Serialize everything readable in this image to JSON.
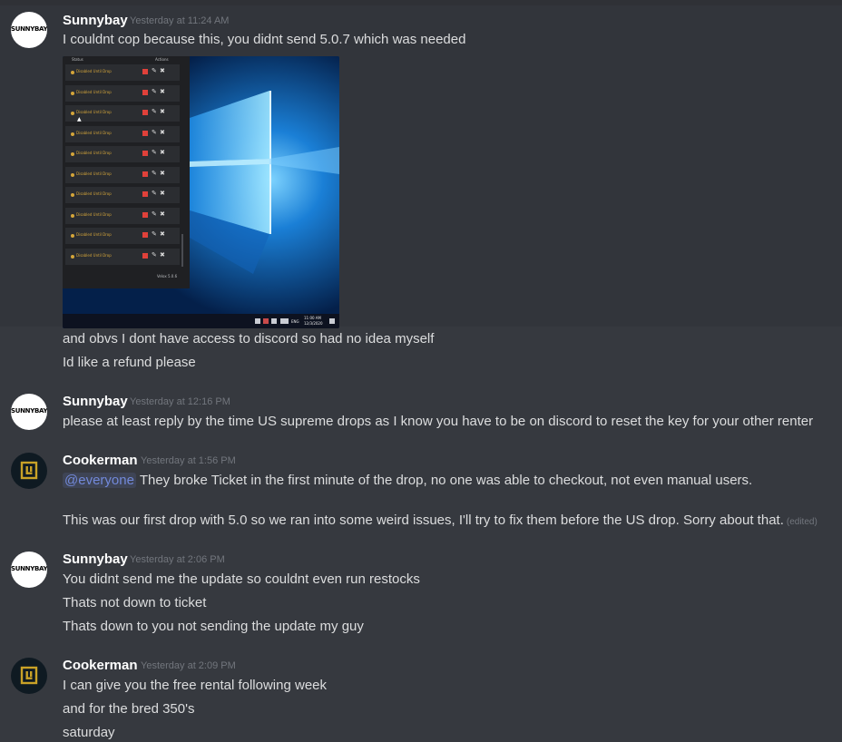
{
  "colors": {
    "background": "#36393f",
    "hover": "#32353b",
    "author": "#ffffff",
    "text": "#dcddde",
    "timestamp": "#72767d",
    "mention": "#7289da",
    "cookerman_logo_gold": "#c9a227"
  },
  "avatars": {
    "sunnybay_text": "SUNNYBAY",
    "cookerman_icon": "cookerman-logo-icon"
  },
  "messages": [
    {
      "author": "Sunnybay",
      "timestamp": "Yesterday at 11:24 AM",
      "lines": [
        "I couldnt cop because this, you didnt send 5.0.7 which was needed"
      ],
      "after_attachment": [
        "and obvs I dont have access to discord so had no idea myself",
        "Id like a refund please"
      ]
    },
    {
      "author": "Sunnybay",
      "timestamp": "Yesterday at 12:16 PM",
      "lines": [
        "please at least reply by the time US supreme drops as I know you have to be on discord to reset the key for your other renter"
      ]
    },
    {
      "author": "Cookerman",
      "timestamp": "Yesterday at 1:56 PM",
      "mention": "@everyone",
      "lines": [
        " They broke Ticket in the first minute of the drop, no one was able to checkout, not even manual users.",
        "This was our first drop with 5.0 so we ran into some weird issues, I'll try to fix them before the US drop. Sorry about that."
      ],
      "edited": "(edited)"
    },
    {
      "author": "Sunnybay",
      "timestamp": "Yesterday at 2:06 PM",
      "lines": [
        "You didnt send me the update so couldnt even run restocks",
        "Thats not down to ticket",
        "Thats down to you not sending the update my guy"
      ]
    },
    {
      "author": "Cookerman",
      "timestamp": "Yesterday at 2:09 PM",
      "lines": [
        "I can give you the free rental following week",
        "and for the bred 350's",
        "saturday"
      ]
    }
  ],
  "attachment": {
    "app": {
      "col_status": "Status",
      "col_actions": "Actions",
      "row_status": "Disabled Until Drop",
      "rows": 10,
      "version": "Velox 5.0.6",
      "edit_icon": "pencil-icon",
      "delete_icon": "trash-icon",
      "stop_icon": "stop-icon"
    },
    "taskbar": {
      "lang": "ENG",
      "time": "11:00 AM",
      "date": "12/3/2020"
    }
  }
}
